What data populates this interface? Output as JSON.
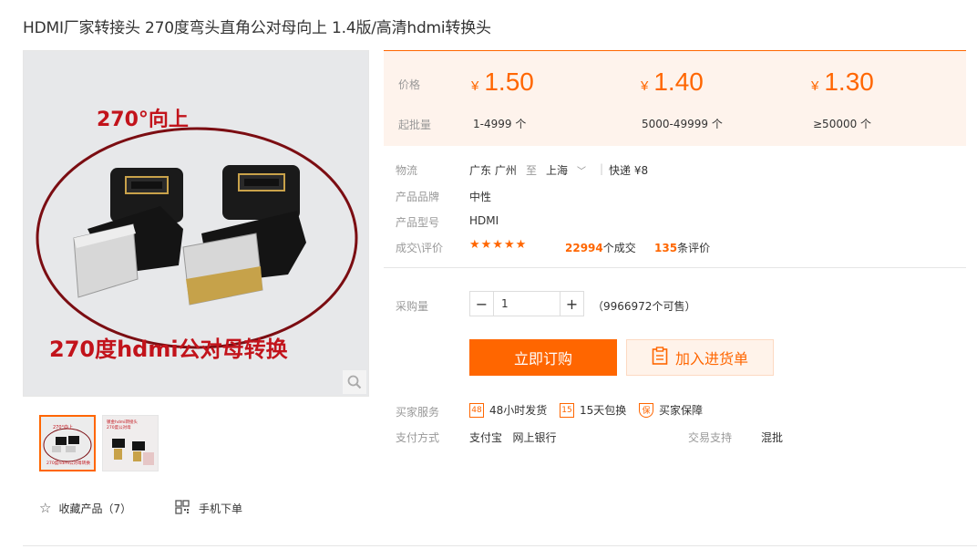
{
  "product": {
    "title": "HDMI厂家转接头 270度弯头直角公对母向上 1.4版/高清hdmi转换头"
  },
  "image": {
    "caption_top": "270°向上",
    "caption_bottom": "270度hdmi公对母转换",
    "thumb1_text_top": "270°向上",
    "thumb1_text_bottom": "270度hdmi公对母转换",
    "thumb2_text_a": "镀金hdmi转接头",
    "thumb2_text_b": "270度公对母"
  },
  "price": {
    "label_price": "价格",
    "label_moq": "起批量",
    "currency": "¥",
    "tiers": [
      {
        "price": "1.50",
        "range": "1-4999 个"
      },
      {
        "price": "1.40",
        "range": "5000-49999 个"
      },
      {
        "price": "1.30",
        "range": "≥50000 个"
      }
    ]
  },
  "logistics": {
    "label": "物流",
    "from": "广东 广州",
    "to_word": "至",
    "to": "上海",
    "shipping": "快递 ¥8"
  },
  "brand": {
    "label": "产品品牌",
    "value": "中性"
  },
  "model": {
    "label": "产品型号",
    "value": "HDMI"
  },
  "reviews": {
    "label": "成交\\评价",
    "stars": "★★★★★",
    "deals": "22994",
    "deals_suffix": "个成交",
    "reviews": "135",
    "reviews_suffix": "条评价"
  },
  "purchase": {
    "label": "采购量",
    "quantity": "1",
    "minus": "−",
    "plus": "+",
    "stock": "（9966972个可售）"
  },
  "actions": {
    "buy": "立即订购",
    "cart": "加入进货单"
  },
  "services": {
    "label": "买家服务",
    "items": [
      {
        "icon": "48",
        "text": "48小时发货"
      },
      {
        "icon": "15",
        "text": "15天包换"
      },
      {
        "icon": "保",
        "text": "买家保障"
      }
    ]
  },
  "payment": {
    "label": "支付方式",
    "methods": "支付宝   网上银行",
    "trade_label": "交易支持",
    "trade_value": "混批"
  },
  "footer": {
    "favorite": "收藏产品（7）",
    "mobile": "手机下单"
  },
  "colors": {
    "accent": "#ff6600",
    "price_bg": "#fef3ec"
  }
}
